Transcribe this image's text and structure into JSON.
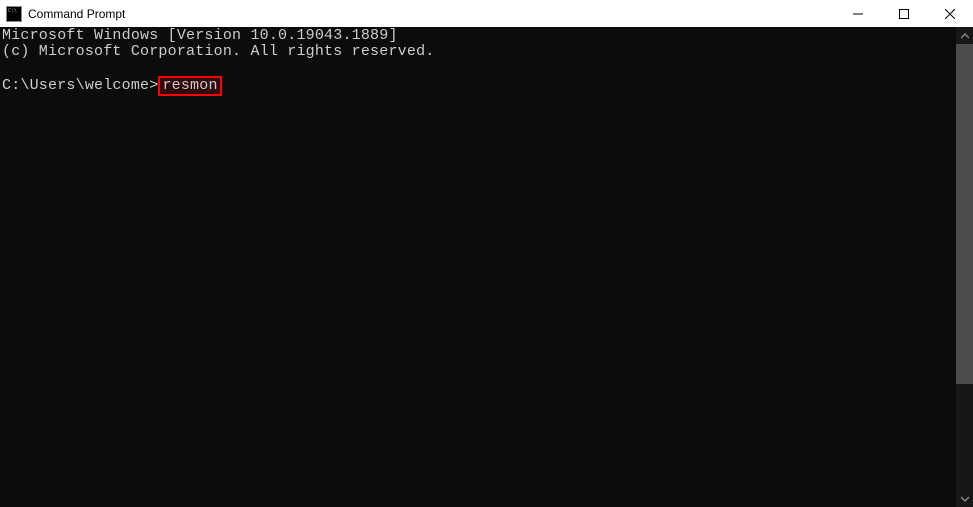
{
  "window": {
    "title": "Command Prompt"
  },
  "terminal": {
    "header_line1": "Microsoft Windows [Version 10.0.19043.1889]",
    "header_line2": "(c) Microsoft Corporation. All rights reserved.",
    "prompt": "C:\\Users\\welcome>",
    "command": "resmon"
  }
}
